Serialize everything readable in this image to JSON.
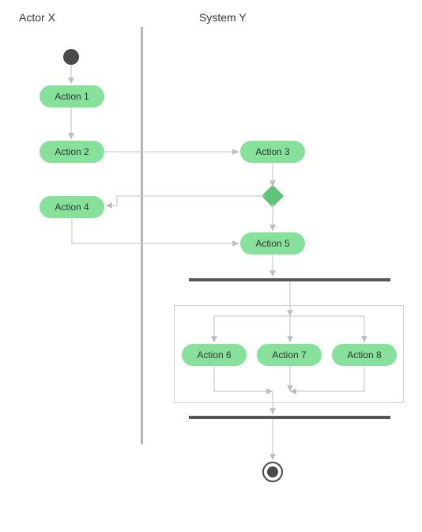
{
  "lanes": {
    "actor": "Actor X",
    "system": "System Y"
  },
  "actions": {
    "a1": "Action 1",
    "a2": "Action 2",
    "a3": "Action 3",
    "a4": "Action 4",
    "a5": "Action 5",
    "a6": "Action 6",
    "a7": "Action 7",
    "a8": "Action 8"
  },
  "diagram": {
    "type": "uml-activity-swimlane",
    "start": "lane:actor",
    "end": "lane:system",
    "flows": [
      [
        "start",
        "a1"
      ],
      [
        "a1",
        "a2"
      ],
      [
        "a2",
        "a3"
      ],
      [
        "a3",
        "decision"
      ],
      [
        "decision",
        "a4"
      ],
      [
        "a4",
        "a5"
      ],
      [
        "decision",
        "a5"
      ],
      [
        "a5",
        "fork"
      ],
      [
        "fork",
        "a6"
      ],
      [
        "fork",
        "a7"
      ],
      [
        "fork",
        "a8"
      ],
      [
        "a6",
        "join"
      ],
      [
        "a7",
        "join"
      ],
      [
        "a8",
        "join"
      ],
      [
        "join",
        "end"
      ]
    ]
  }
}
